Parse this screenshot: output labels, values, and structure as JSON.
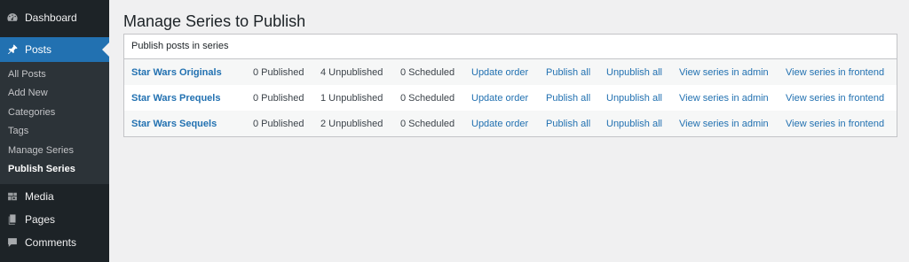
{
  "sidebar": {
    "dashboard": "Dashboard",
    "posts": "Posts",
    "submenu": [
      "All Posts",
      "Add New",
      "Categories",
      "Tags",
      "Manage Series",
      "Publish Series"
    ],
    "media": "Media",
    "pages": "Pages",
    "comments": "Comments"
  },
  "page": {
    "title": "Manage Series to Publish"
  },
  "table": {
    "header": "Publish posts in series",
    "rows": [
      {
        "name": "Star Wars Originals",
        "published": "0 Published",
        "unpublished": "4 Unpublished",
        "scheduled": "0 Scheduled"
      },
      {
        "name": "Star Wars Prequels",
        "published": "0 Published",
        "unpublished": "1 Unpublished",
        "scheduled": "0 Scheduled"
      },
      {
        "name": "Star Wars Sequels",
        "published": "0 Published",
        "unpublished": "2 Unpublished",
        "scheduled": "0 Scheduled"
      }
    ],
    "actions": {
      "update_order": "Update order",
      "publish_all": "Publish all",
      "unpublish_all": "Unpublish all",
      "view_admin": "View series in admin",
      "view_frontend": "View series in frontend"
    }
  },
  "colors": {
    "sidebar_bg": "#1d2327",
    "submenu_bg": "#2c3338",
    "accent": "#2271b1",
    "link": "#2271b1"
  }
}
